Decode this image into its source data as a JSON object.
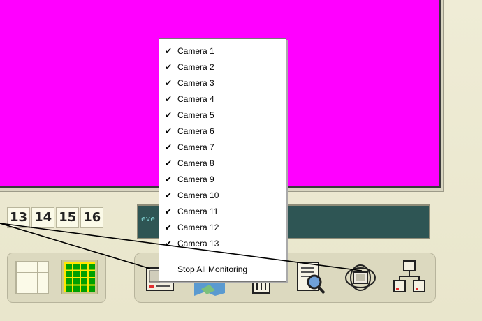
{
  "channels": [
    "13",
    "14",
    "15",
    "16"
  ],
  "event_log": {
    "text": "eve"
  },
  "context_menu": {
    "items": [
      {
        "label": "Camera 1",
        "checked": true
      },
      {
        "label": "Camera 2",
        "checked": true
      },
      {
        "label": "Camera 3",
        "checked": true
      },
      {
        "label": "Camera 4",
        "checked": true
      },
      {
        "label": "Camera 5",
        "checked": true
      },
      {
        "label": "Camera 6",
        "checked": true
      },
      {
        "label": "Camera 7",
        "checked": true
      },
      {
        "label": "Camera 8",
        "checked": true
      },
      {
        "label": "Camera 9",
        "checked": true
      },
      {
        "label": "Camera 10",
        "checked": true
      },
      {
        "label": "Camera 11",
        "checked": true
      },
      {
        "label": "Camera 12",
        "checked": true
      },
      {
        "label": "Camera 13",
        "checked": true
      }
    ],
    "stop_all": "Stop All Monitoring",
    "check_glyph": "✔"
  },
  "colors": {
    "video_background": "#ff00ff",
    "event_background": "#2e5554",
    "grid_green": "#00a000",
    "grid_yellow": "#ffe800"
  },
  "toolbar_icons": [
    "camera-monitor-icon",
    "map-icon",
    "recorder-icon",
    "search-document-icon",
    "network-globe-icon",
    "network-topology-icon"
  ]
}
